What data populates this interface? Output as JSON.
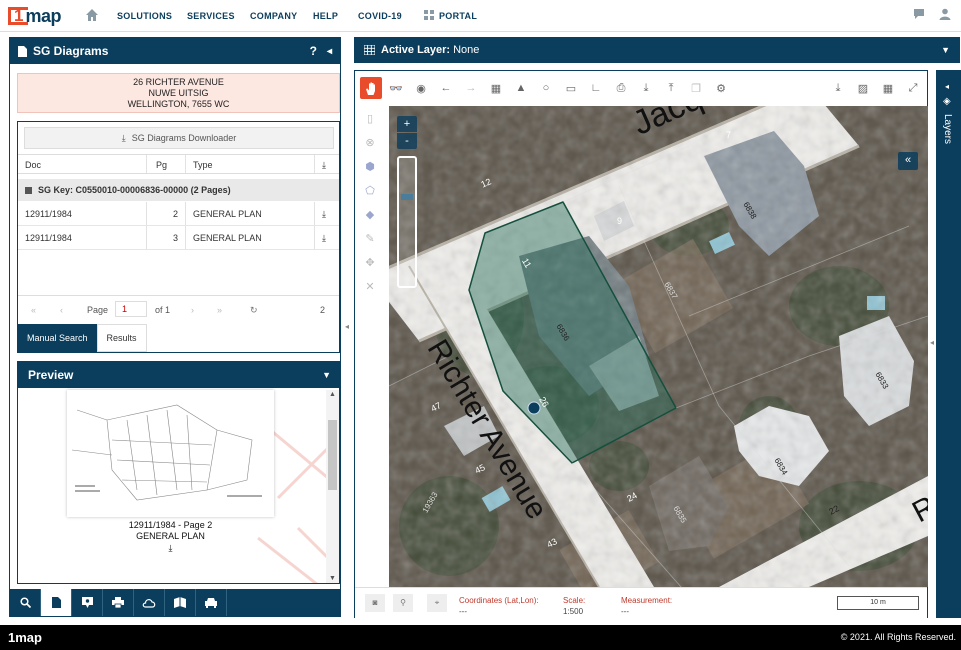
{
  "brand": {
    "logo_text": "map",
    "footer_logo": "1map"
  },
  "nav": {
    "items": [
      "SOLUTIONS",
      "SERVICES",
      "COMPANY",
      "HELP",
      "COVID-19",
      "PORTAL"
    ]
  },
  "left_panel": {
    "title": "SG Diagrams",
    "help": "?",
    "address": {
      "line1": "26 RICHTER AVENUE",
      "line2": "NUWE UITSIG",
      "line3": "WELLINGTON, 7655 WC"
    },
    "downloader_label": "SG Diagrams Downloader",
    "table": {
      "headers": [
        "Doc",
        "Pg",
        "Type"
      ],
      "group_label": "SG Key: C0550010-00006836-00000 (2 Pages)",
      "rows": [
        {
          "doc": "12911/1984",
          "pg": "2",
          "type": "GENERAL PLAN"
        },
        {
          "doc": "12911/1984",
          "pg": "3",
          "type": "GENERAL PLAN"
        }
      ]
    },
    "pager": {
      "page_label": "Page",
      "page_value": "1",
      "of_label": "of 1",
      "count": "2"
    },
    "tabs": [
      {
        "label": "Manual Search",
        "active": true
      },
      {
        "label": "Results",
        "active": false
      }
    ],
    "preview": {
      "title": "Preview",
      "caption_line1": "12911/1984 - Page 2",
      "caption_line2": "GENERAL PLAN"
    }
  },
  "map_panel": {
    "active_layer_label": "Active Layer:",
    "active_layer_value": "None",
    "street_main": "Richter Avenue",
    "street_top": "Jacq",
    "street_right": "R",
    "labels": [
      "12",
      "7",
      "6838",
      "9",
      "11",
      "6837",
      "6836",
      "26",
      "47",
      "45",
      "24",
      "6835",
      "6834",
      "6833",
      "22",
      "43",
      "19363"
    ],
    "status": {
      "coords_label": "Coordinates (Lat,Lon):",
      "coords_value": "---",
      "scale_label": "Scale:",
      "scale_value": "1:500",
      "measure_label": "Measurement:",
      "measure_value": "---",
      "scale_bar": "10 m"
    },
    "zoom_in": "+",
    "zoom_out": "-",
    "info_btn": "i"
  },
  "layers_panel": {
    "label": "Layers"
  },
  "footer": {
    "copyright": "© 2021. All Rights Reserved."
  },
  "colors": {
    "brand_navy": "#0b3d5c",
    "brand_red": "#e84c2b"
  }
}
